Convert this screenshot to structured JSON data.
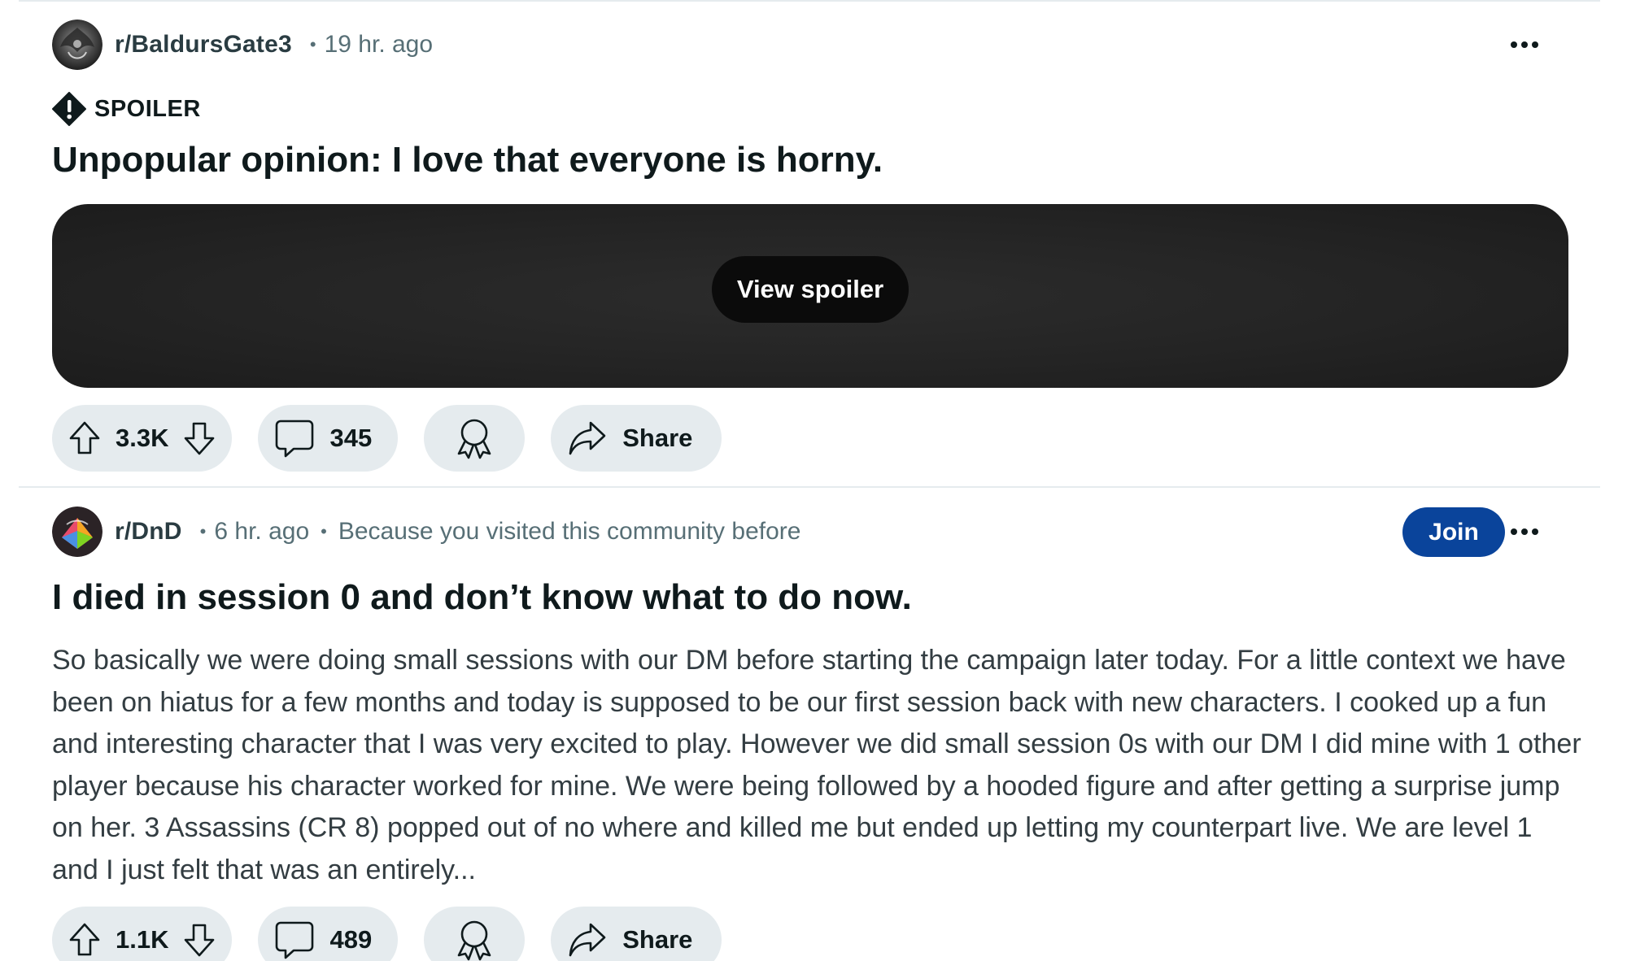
{
  "posts": [
    {
      "subreddit": "r/BaldursGate3",
      "time": "19 hr. ago",
      "reason": "",
      "flair": "SPOILER",
      "title": "Unpopular opinion: I love that everyone is horny.",
      "spoiler_button": "View spoiler",
      "votes": "3.3K",
      "comments": "345",
      "share_label": "Share"
    },
    {
      "subreddit": "r/DnD",
      "time": "6 hr. ago",
      "reason": "Because you visited this community before",
      "join_label": "Join",
      "title": "I died in session 0 and don’t know what to do now.",
      "body": "So basically we were doing small sessions with our DM before starting the campaign later today. For a little context we have been on hiatus for a few months and today is supposed to be our first session back with new characters. I cooked up a fun and interesting character that I was very excited to play. However we did small session 0s with our DM I did mine with 1 other player because his character worked for mine. We were being followed by a hooded figure and after getting a surprise jump on her. 3 Assassins (CR 8) popped out of no where and killed me but ended up letting my counterpart live. We are level 1 and I just felt that was an entirely...",
      "votes": "1.1K",
      "comments": "489",
      "share_label": "Share"
    }
  ],
  "colors": {
    "pill_bg": "#e5ebee",
    "join_bg": "#0a449b",
    "meta_text": "#576f76",
    "spoiler_bg": "#242424"
  },
  "icons": [
    "upvote-icon",
    "downvote-icon",
    "comment-icon",
    "award-icon",
    "share-icon",
    "spoiler-icon",
    "more-icon"
  ]
}
